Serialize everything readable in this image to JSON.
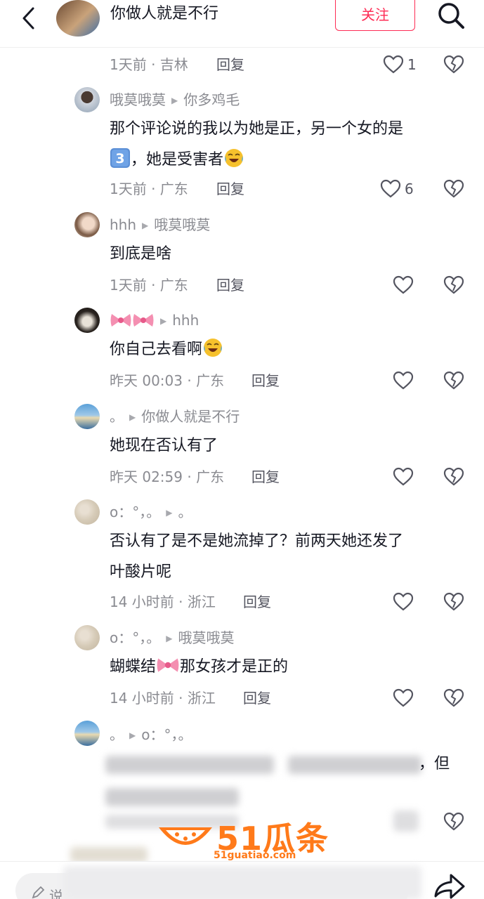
{
  "header": {
    "title": "你做人就是不行",
    "follow_label": "关注"
  },
  "comments": [
    {
      "meta_time": "1天前 · 吉林",
      "reply": "回复",
      "likes": "1"
    },
    {
      "user": "哦莫哦莫",
      "to": "你多鸡毛",
      "text_a": "那个评论说的我以为她是正，另一个女的是",
      "text_b": "，她是受害者",
      "meta_time": "1天前 · 广东",
      "reply": "回复",
      "likes": "6"
    },
    {
      "user": "hhh",
      "to": "哦莫哦莫",
      "text": "到底是啥",
      "meta_time": "1天前 · 广东",
      "reply": "回复"
    },
    {
      "user": "",
      "to": "hhh",
      "text": "你自己去看啊",
      "meta_time": "昨天 00:03 · 广东",
      "reply": "回复"
    },
    {
      "user": "。",
      "to": "你做人就是不行",
      "text": "她现在否认有了",
      "meta_time": "昨天 02:59 · 广东",
      "reply": "回复"
    },
    {
      "user": "o：°，。",
      "to": "。",
      "text_line1": "否认有了是不是她流掉了？前两天她还发了",
      "text_line2": "叶酸片呢",
      "meta_time": "14 小时前 · 浙江",
      "reply": "回复"
    },
    {
      "user": "o：°，。",
      "to": "哦莫哦莫",
      "text_a": "蝴蝶结",
      "text_b": "那女孩才是正的",
      "meta_time": "14 小时前 · 浙江",
      "reply": "回复"
    },
    {
      "user": "。",
      "to": "o：°，。",
      "visible_tail": "，但"
    }
  ],
  "watermark": {
    "brand": "51瓜条",
    "url": "51guatiao.com"
  },
  "bottom": {
    "input_placeholder": "说"
  },
  "icons": [
    "back-icon",
    "search-icon",
    "heart-icon",
    "broken-heart-icon",
    "bow-emoji",
    "laughing-crying-emoji",
    "keycap-three-emoji",
    "pencil-icon",
    "share-icon"
  ],
  "colors": {
    "accent": "#fe2c55",
    "muted": "#8a8b91",
    "watermark": "#ff7a1a"
  }
}
